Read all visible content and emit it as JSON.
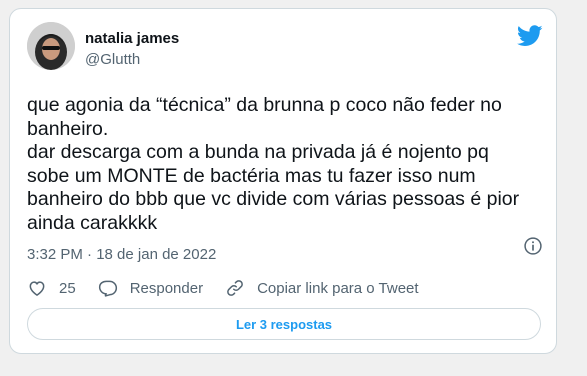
{
  "tweet": {
    "author": {
      "name": "natalia james",
      "handle": "@Glutth"
    },
    "text": "que agonia da “técnica” da brunna p coco não feder no\nbanheiro.\ndar descarga com a bunda na privada já é nojento pq\nsobe um MONTE de bactéria mas tu fazer isso num\nbanheiro do bbb que vc divide com várias pessoas é pior\nainda carakkkk",
    "timestamp": "3:32 PM · 18 de jan de 2022",
    "actions": {
      "like_count": "25",
      "reply_label": "Responder",
      "copy_link_label": "Copiar link para o Tweet"
    },
    "read_replies_label": "Ler 3 respostas"
  },
  "icons": {
    "logo": "twitter-bird-icon",
    "info": "info-icon",
    "like": "heart-icon",
    "reply": "reply-icon",
    "link": "link-icon"
  },
  "colors": {
    "brand": "#1d9bf0",
    "text": "#0f1419",
    "secondary_text": "#536471",
    "border": "#cfd9de"
  }
}
